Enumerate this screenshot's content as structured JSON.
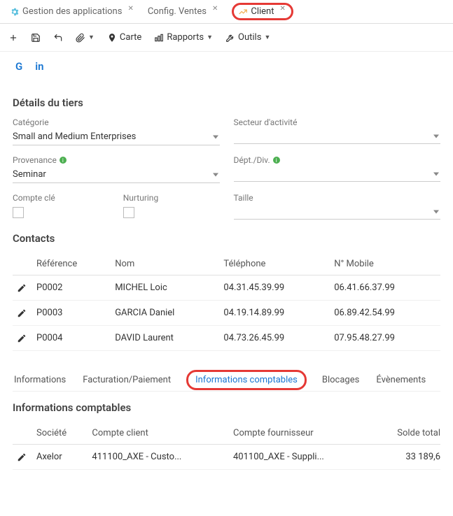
{
  "tabs": [
    {
      "label": "Gestion des applications"
    },
    {
      "label": "Config. Ventes"
    },
    {
      "label": "Client"
    }
  ],
  "toolbar": {
    "carte": "Carte",
    "rapports": "Rapports",
    "outils": "Outils"
  },
  "social": {
    "g": "G",
    "in": "in"
  },
  "details": {
    "title": "Détails du tiers",
    "categorie_label": "Catégorie",
    "categorie_value": "Small and Medium Enterprises",
    "secteur_label": "Secteur d'activité",
    "secteur_value": "",
    "provenance_label": "Provenance",
    "provenance_value": "Seminar",
    "deptdiv_label": "Dépt./Div.",
    "deptdiv_value": "",
    "compte_cle_label": "Compte clé",
    "nurturing_label": "Nurturing",
    "taille_label": "Taille",
    "taille_value": ""
  },
  "contacts": {
    "title": "Contacts",
    "headers": {
      "ref": "Référence",
      "nom": "Nom",
      "tel": "Téléphone",
      "mob": "N° Mobile"
    },
    "rows": [
      {
        "ref": "P0002",
        "nom": "MICHEL Loic",
        "tel": "04.31.45.39.99",
        "mob": "06.41.66.37.99"
      },
      {
        "ref": "P0003",
        "nom": "GARCIA Daniel",
        "tel": "04.19.14.89.99",
        "mob": "06.89.42.54.99"
      },
      {
        "ref": "P0004",
        "nom": "DAVID Laurent",
        "tel": "04.73.26.45.99",
        "mob": "07.95.48.27.99"
      }
    ]
  },
  "subtabs": {
    "informations": "Informations",
    "facturation": "Facturation/Paiement",
    "comptables": "Informations comptables",
    "blocages": "Blocages",
    "evenements": "Évènements"
  },
  "accounting": {
    "title": "Informations comptables",
    "headers": {
      "soc": "Société",
      "client": "Compte client",
      "fourn": "Compte fournisseur",
      "solde": "Solde total"
    },
    "rows": [
      {
        "soc": "Axelor",
        "client": "411100_AXE - Custo...",
        "fourn": "401100_AXE - Suppli...",
        "solde": "33 189,6"
      }
    ]
  }
}
